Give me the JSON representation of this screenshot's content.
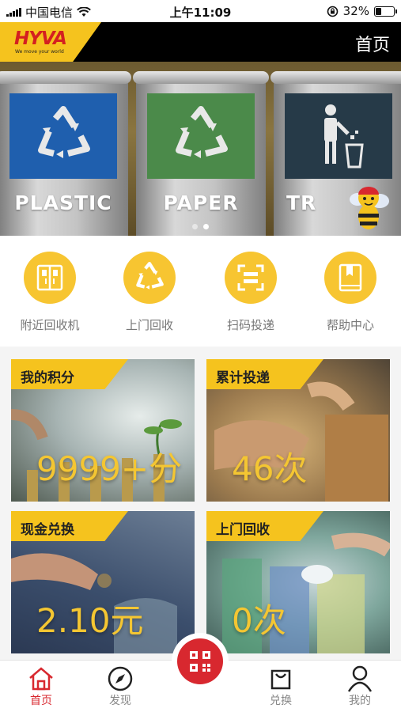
{
  "status_bar": {
    "carrier": "中国电信",
    "time": "上午11:09",
    "battery": "32%",
    "battery_level": 0.32
  },
  "header": {
    "logo_text": "HYVA",
    "logo_tagline": "We move your world",
    "title": "首页"
  },
  "banner": {
    "bins": [
      {
        "label": "PLASTIC",
        "color": "#1f5fae"
      },
      {
        "label": "PAPER",
        "color": "#4b8a4a"
      },
      {
        "label": "TR",
        "color": "#263a48"
      }
    ],
    "page_count": 2,
    "active_page": 2
  },
  "quick_menu": [
    {
      "label": "附近回收机",
      "icon": "recycle-machine-icon"
    },
    {
      "label": "上门回收",
      "icon": "recycle-symbol-icon"
    },
    {
      "label": "扫码投递",
      "icon": "scan-frame-icon"
    },
    {
      "label": "帮助中心",
      "icon": "book-icon"
    }
  ],
  "cards": {
    "points": {
      "title": "我的积分",
      "value": "9999+分"
    },
    "deliveries": {
      "title": "累计投递",
      "value": "46次"
    },
    "cash": {
      "title": "现金兑换",
      "value": "2.10元"
    },
    "pickup": {
      "title": "上门回收",
      "value": "0次"
    }
  },
  "tab_bar": {
    "home": "首页",
    "discover": "发现",
    "exchange": "兑换",
    "mine": "我的",
    "active": "home"
  },
  "colors": {
    "accent_yellow": "#f5c31e",
    "active_red": "#d8282f",
    "header_black": "#000000"
  }
}
